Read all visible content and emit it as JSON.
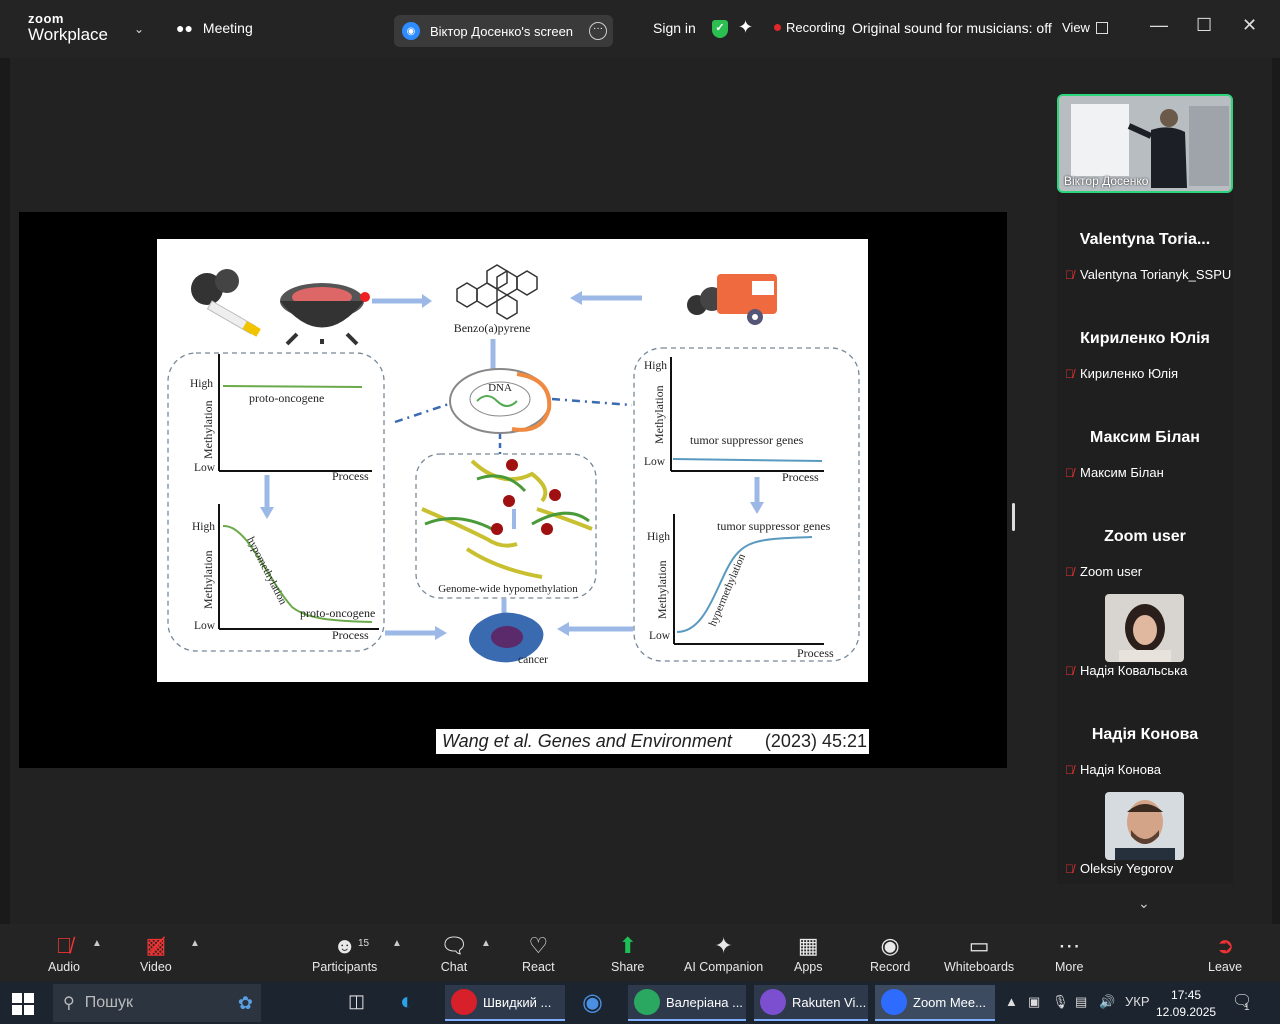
{
  "titlebar": {
    "logo_top": "zoom",
    "logo_bottom": "Workplace",
    "meeting_label": "Meeting",
    "screen_share_label": "Віктор Досенко's screen",
    "sign_in": "Sign in",
    "recording": "Recording",
    "original_sound": "Original sound for musicians: off",
    "view": "View"
  },
  "slide": {
    "benzo": "Benzo(a)pyrene",
    "dna": "DNA",
    "genome": "Genome-wide hypomethylation",
    "cancer": "cancer",
    "g1_high": "High",
    "g1_low": "Low",
    "g1_ylabel": "Methylation",
    "g1_curve": "proto-oncogene",
    "g1_x": "Process",
    "g2_high": "High",
    "g2_low": "Low",
    "g2_ylabel": "Methylation",
    "g2_curve": "hypomethylation",
    "g2_curve2": "proto-oncogene",
    "g2_x": "Process",
    "g3_high": "High",
    "g3_low": "Low",
    "g3_ylabel": "Methylation",
    "g3_curve": "tumor suppressor genes",
    "g3_x": "Process",
    "g4_high": "High",
    "g4_low": "Low",
    "g4_ylabel": "Methylation",
    "g4_curve": "tumor suppressor genes",
    "g4_curve2": "hypermethylation",
    "g4_x": "Process"
  },
  "citation": {
    "authors": "Wang et al. Genes and Environment",
    "ref": "(2023) 45:21"
  },
  "participants": [
    {
      "video_name": "Віктор Досенко"
    },
    {
      "big": "Valentyna  Toria...",
      "small": "Valentyna Torianyk_SSPU"
    },
    {
      "big": "Кириленко Юлія",
      "small": "Кириленко Юлія"
    },
    {
      "big": "Максим Білан",
      "small": "Максим Білан"
    },
    {
      "big": "Zoom user",
      "small": "Zoom user"
    },
    {
      "small": "Надія Ковальська"
    },
    {
      "big": "Надія Конова",
      "small": "Надія Конова"
    },
    {
      "small": "Oleksiy Yegorov"
    }
  ],
  "toolbar": {
    "audio": "Audio",
    "video": "Video",
    "participants": "Participants",
    "participants_count": "15",
    "chat": "Chat",
    "react": "React",
    "share": "Share",
    "ai_companion": "AI Companion",
    "apps": "Apps",
    "record": "Record",
    "whiteboards": "Whiteboards",
    "more": "More",
    "leave": "Leave"
  },
  "taskbar": {
    "search": "Пошук",
    "app1": "Швидкий ...",
    "app2": "Валеріана ...",
    "app3": "Rakuten Vi...",
    "app4": "Zoom Mee...",
    "lang": "УКР",
    "time": "17:45",
    "date": "12.09.2025",
    "notifications": "1"
  },
  "colors": {
    "accent_green": "#2bd67b",
    "share_green": "#1dbf57",
    "record_red": "#e02828"
  }
}
